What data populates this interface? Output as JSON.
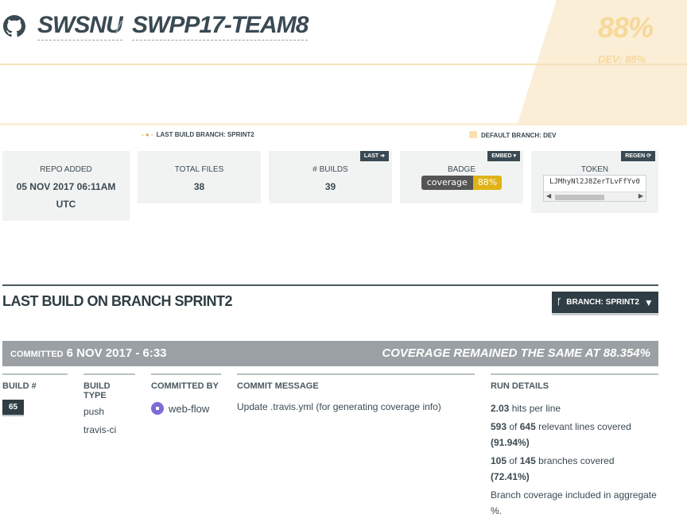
{
  "header": {
    "org": "SWSNU",
    "separator": "/",
    "repo": "SWPP17-TEAM8",
    "coverage": "88%",
    "dev_coverage": "DEV: 88%"
  },
  "legend": {
    "last_build_branch": "LAST BUILD BRANCH: SPRINT2",
    "default_branch": "DEFAULT BRANCH: DEV"
  },
  "cards": {
    "repo_added_label": "REPO ADDED",
    "repo_added_value_1": "05 NOV 2017 06:11AM",
    "repo_added_value_2": "UTC",
    "total_files_label": "TOTAL FILES",
    "total_files_value": "38",
    "builds_label": "# BUILDS",
    "builds_value": "39",
    "builds_tag": "LAST",
    "badge_label": "BADGE",
    "badge_tag": "EMBED ▾",
    "badge_left": "coverage",
    "badge_right": "88%",
    "token_label": "TOKEN",
    "token_tag": "REGEN",
    "token_value": "LJMhyNl2J8ZerTLvFfYv0"
  },
  "last_build": {
    "title": "LAST BUILD ON BRANCH SPRINT2",
    "branch_button": "BRANCH: SPRINT2",
    "committed_label": "COMMITTED",
    "committed_date": "6 NOV 2017 - 6:33",
    "coverage_status": "COVERAGE REMAINED THE SAME AT 88.354%",
    "columns": {
      "build_num": "BUILD #",
      "build_type": "BUILD TYPE",
      "committed_by": "COMMITTED BY",
      "commit_message": "COMMIT MESSAGE",
      "run_details": "RUN DETAILS"
    },
    "build_number": "65",
    "build_type_1": "push",
    "build_type_2": "travis-ci",
    "committer": "web-flow",
    "message": "Update .travis.yml (for generating coverage info)",
    "run": {
      "hits": "2.03",
      "hits_text": "hits per line",
      "lines_covered": "593",
      "of_1": "of",
      "lines_total": "645",
      "lines_text": "relevant lines covered",
      "lines_pct": "(91.94%)",
      "branches_covered": "105",
      "of_2": "of",
      "branches_total": "145",
      "branches_text": "branches covered",
      "branches_pct": "(72.41%)",
      "note": "Branch coverage included in aggregate %."
    }
  }
}
